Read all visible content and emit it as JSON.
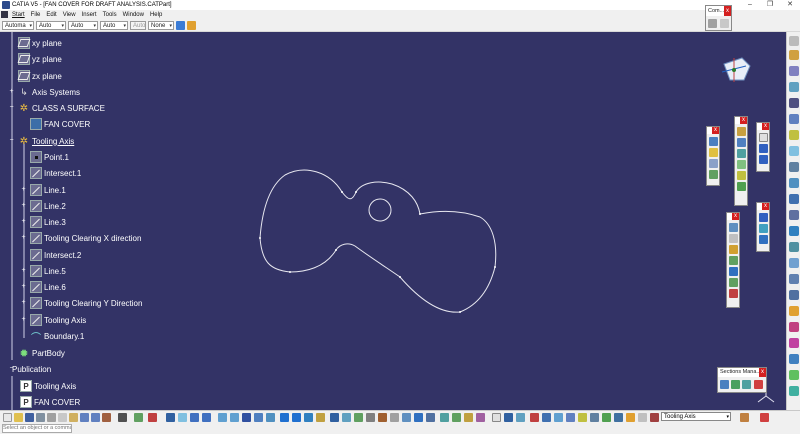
{
  "window": {
    "title": "CATIA V5 - [FAN COVER FOR DRAFT ANALYSIS.CATPart]",
    "controls": [
      "–",
      "❐",
      "✕"
    ]
  },
  "menu": [
    "Start",
    "File",
    "Edit",
    "View",
    "Insert",
    "Tools",
    "Window",
    "Help"
  ],
  "properties": {
    "color": "Automa",
    "transparency": "Auto",
    "linetype": "Auto",
    "thickness": "Auto",
    "layer": "Auto",
    "style": "None"
  },
  "tree": {
    "items": [
      {
        "label": "xy plane",
        "icon": "plane-icon"
      },
      {
        "label": "yz plane",
        "icon": "plane-icon"
      },
      {
        "label": "zx plane",
        "icon": "plane-icon"
      },
      {
        "label": "Axis Systems",
        "icon": "axis-icon"
      },
      {
        "label": "CLASS A SURFACE",
        "icon": "geoset-icon"
      },
      {
        "label": "FAN COVER",
        "icon": "surface-icon"
      },
      {
        "label": "Tooling Axis",
        "icon": "geoset-icon"
      },
      {
        "label": "Point.1",
        "icon": "point-icon"
      },
      {
        "label": "Intersect.1",
        "icon": "intersect-icon"
      },
      {
        "label": "Line.1",
        "icon": "line-icon"
      },
      {
        "label": "Line.2",
        "icon": "line-icon"
      },
      {
        "label": "Line.3",
        "icon": "line-icon"
      },
      {
        "label": "Tooling Clearing X direction",
        "icon": "line-icon"
      },
      {
        "label": "Intersect.2",
        "icon": "intersect-icon"
      },
      {
        "label": "Line.5",
        "icon": "line-icon"
      },
      {
        "label": "Line.6",
        "icon": "line-icon"
      },
      {
        "label": "Tooling Clearing Y Direction",
        "icon": "line-icon"
      },
      {
        "label": "Tooling Axis",
        "icon": "line-icon"
      },
      {
        "label": "Boundary.1",
        "icon": "boundary-icon"
      },
      {
        "label": "PartBody",
        "icon": "partbody-icon"
      },
      {
        "label": "Publication",
        "icon": "publication-icon"
      },
      {
        "label": "Tooling Axis",
        "icon": "publication-icon"
      },
      {
        "label": "FAN COVER",
        "icon": "publication-icon"
      }
    ]
  },
  "panels": {
    "commands": {
      "title": "Com..."
    },
    "sections": {
      "title": "Sections Mana..."
    }
  },
  "workbench": {
    "value": "Tooling Axis"
  },
  "status": {
    "placeholder": "Select an object or a command"
  },
  "colors": {
    "viewport": "#333366",
    "curve": "#ffffff",
    "chrome": "#f0f0f0"
  }
}
